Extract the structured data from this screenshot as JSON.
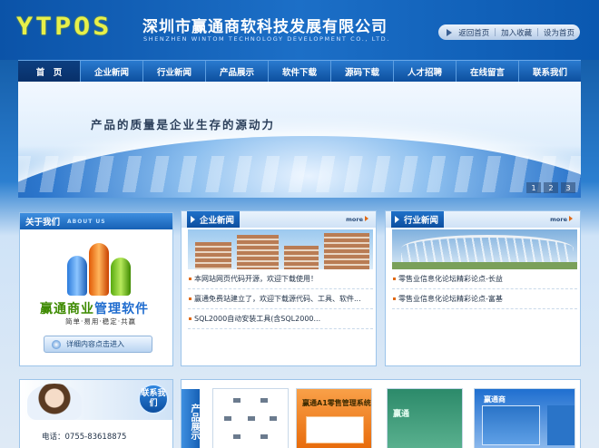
{
  "header": {
    "logo": "YTPOS",
    "company_cn": "深圳市赢通商软科技发展有限公司",
    "company_en": "SHENZHEN WINTOM TECHNOLOGY DEVELOPMENT CO., LTD.",
    "links": [
      "返回首页",
      "加入收藏",
      "设为首页"
    ]
  },
  "nav": [
    "首　页",
    "企业新闻",
    "行业新闻",
    "产品展示",
    "软件下载",
    "源码下载",
    "人才招聘",
    "在线留言",
    "联系我们"
  ],
  "banner": {
    "slogan": "产品的质量是企业生存的源动力",
    "pages": [
      "1",
      "2",
      "3"
    ]
  },
  "about": {
    "title": "关于我们",
    "subtitle": "ABOUT US",
    "product_green": "赢通商业",
    "product_blue": "管理软件",
    "features": "简单·易用·稳定·共赢",
    "detail_button": "详细内容点击进入"
  },
  "company_news": {
    "title": "企业新闻",
    "more": "more",
    "items": [
      "本网站网页代码开源，欢迎下载使用！",
      "赢通免费站建立了，欢迎下载源代码、工具、软件...",
      "SQL2000自动安装工具(含SQL2000..."
    ]
  },
  "industry_news": {
    "title": "行业新闻",
    "more": "more",
    "items": [
      "零售业信息化论坛精彩论点-长益",
      "零售业信息化论坛精彩论点-富基"
    ]
  },
  "contact": {
    "badge": "联系我们",
    "phone": "电话：0755-83618875"
  },
  "products": {
    "title": "产品展示",
    "thumb2_heading": "赢通A1零售管理系统",
    "thumb3_heading": "赢通",
    "thumb4_heading": "赢通商"
  },
  "colors": {
    "brand_blue": "#1660b5",
    "logo_yellow": "#e7f04a",
    "accent_orange": "#e06a16"
  }
}
